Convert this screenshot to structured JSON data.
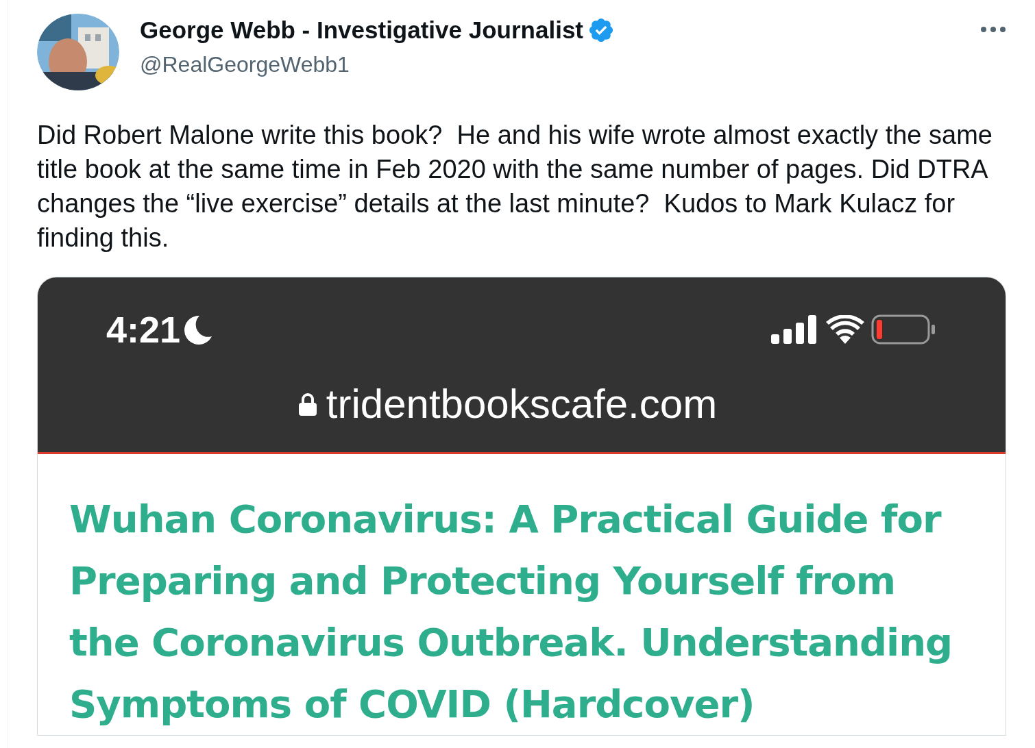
{
  "author": {
    "name": "George Webb - Investigative Journalist",
    "verified": true,
    "handle": "@RealGeorgeWebb1"
  },
  "text": "Did Robert Malone write this book?  He and his wife wrote almost exactly the same title book at the same time in Feb 2020 with the same number of pages. Did DTRA changes the “live exercise” details at the last minute?  Kudos to Mark Kulacz for finding this.",
  "media": {
    "status_bar": {
      "time": "4:21"
    },
    "address_bar": {
      "url": "tridentbookscafe.com"
    },
    "page_title": "Wuhan Coronavirus: A Practical Guide for Preparing and Protecting Yourself from the Coronavirus Outbreak. Understanding Symptoms of COVID (Hardcover)"
  }
}
